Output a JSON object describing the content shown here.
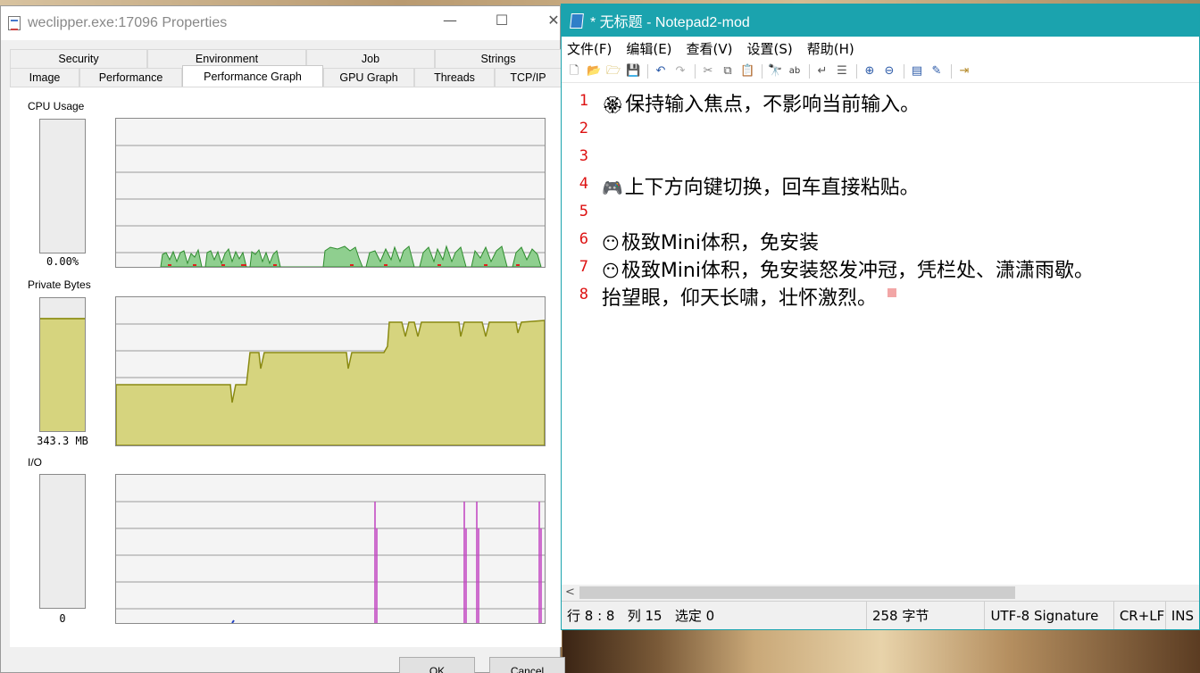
{
  "props_window": {
    "title": "weclipper.exe:17096 Properties",
    "controls": {
      "minimize": "—",
      "maximize": "☐",
      "close": "✕"
    },
    "tabs_row1": [
      "Security",
      "Environment",
      "Job",
      "Strings"
    ],
    "tabs_row2": [
      "Image",
      "Performance",
      "Performance Graph",
      "GPU Graph",
      "Threads",
      "TCP/IP"
    ],
    "active_tab": "Performance Graph",
    "sections": {
      "cpu": {
        "label": "CPU Usage",
        "value": "0.00%"
      },
      "private_bytes": {
        "label": "Private Bytes",
        "value": "343.3 MB",
        "gauge_fraction": 0.85
      },
      "io": {
        "label": "I/O",
        "value": "0"
      }
    },
    "buttons": {
      "ok": "OK",
      "cancel": "Cancel"
    }
  },
  "notepad": {
    "title": "* 无标题 - Notepad2-mod",
    "menu": [
      "文件(F)",
      "编辑(E)",
      "查看(V)",
      "设置(S)",
      "帮助(H)"
    ],
    "toolbar_icons": [
      "new-file-icon",
      "open-file-icon",
      "browse-icon",
      "save-icon",
      "undo-icon",
      "redo-icon",
      "cut-icon",
      "copy-icon",
      "paste-icon",
      "find-icon",
      "replace-icon",
      "word-wrap-icon",
      "line-numbers-icon",
      "zoom-in-icon",
      "zoom-out-icon",
      "scheme-icon",
      "customize-icon",
      "exit-icon"
    ],
    "lines": [
      {
        "num": "1",
        "emoji": "🏵",
        "text": "保持输入焦点，不影响当前输入。"
      },
      {
        "num": "2",
        "emoji": "",
        "text": ""
      },
      {
        "num": "3",
        "emoji": "",
        "text": ""
      },
      {
        "num": "4",
        "emoji": "🎮",
        "text": "上下方向键切换，回车直接粘贴。"
      },
      {
        "num": "5",
        "emoji": "",
        "text": ""
      },
      {
        "num": "6",
        "emoji": "😶",
        "text": "极致Mini体积，免安装"
      },
      {
        "num": "7",
        "emoji": "😶",
        "text": "极致Mini体积，免安装怒发冲冠，凭栏处、潇潇雨歇。"
      },
      {
        "num": "8",
        "emoji": "",
        "text": "抬望眼，仰天长啸，壮怀激烈。"
      }
    ],
    "status": {
      "position": "行 8 : 8   列 15   选定 0",
      "size": "258 字节",
      "encoding": "UTF-8 Signature",
      "eol": "CR+LF",
      "mode": "INS"
    }
  }
}
